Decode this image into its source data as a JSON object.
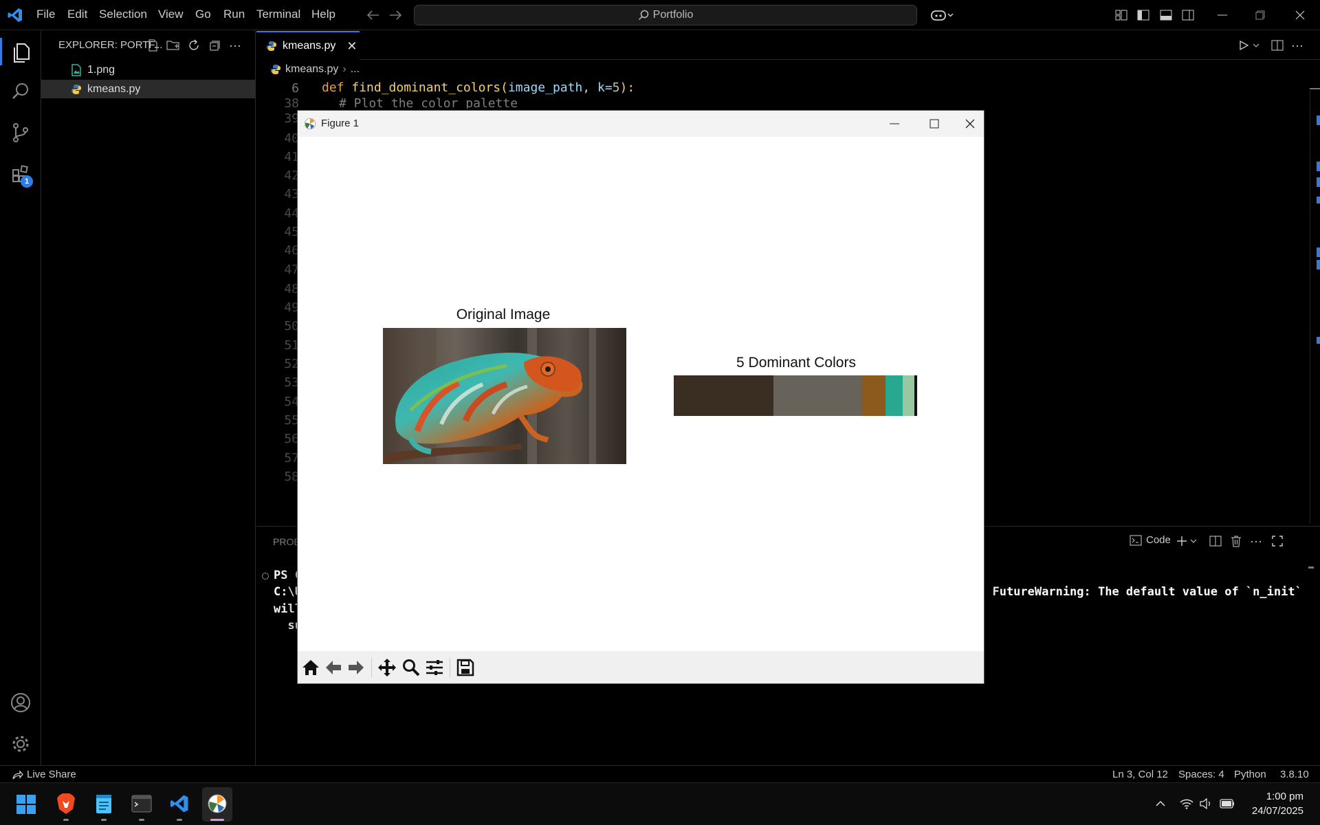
{
  "titlebar": {
    "menus": [
      "File",
      "Edit",
      "Selection",
      "View",
      "Go",
      "Run",
      "Terminal",
      "Help"
    ],
    "search": "Portfolio"
  },
  "sidebar": {
    "title": "EXPLORER: PORTF...",
    "files": [
      {
        "name": "1.png",
        "icon": "image-file-icon"
      },
      {
        "name": "kmeans.py",
        "icon": "python-file-icon"
      }
    ]
  },
  "activity": {
    "extensions_badge": "1"
  },
  "editor": {
    "tab": "kmeans.py",
    "breadcrumb_file": "kmeans.py",
    "breadcrumb_rest": "...",
    "sticky_line_number": "6",
    "sticky_code": {
      "def": "def",
      "fn": "find_dominant_colors",
      "args": "image_path, k=",
      "num": "5",
      "end": "):"
    },
    "partial_comment": "# Plot the color palette",
    "line_numbers": [
      "38",
      "39",
      "40",
      "41",
      "42",
      "43",
      "44",
      "45",
      "46",
      "47",
      "48",
      "49",
      "50",
      "51",
      "52",
      "53",
      "54",
      "55",
      "56",
      "57",
      "58"
    ]
  },
  "panel": {
    "tab_partial": "PROB",
    "terminal_name": "Code",
    "lines": [
      "PS C",
      "C:\\U",
      "will",
      "  su"
    ],
    "warning": ": FutureWarning: The default value of `n_init`"
  },
  "statusbar": {
    "live_share": "Live Share",
    "position": "Ln 3, Col 12",
    "spaces": "Spaces: 4",
    "language": "Python",
    "version": "3.8.10"
  },
  "taskbar": {
    "time": "1:00 pm",
    "date": "24/07/2025"
  },
  "figure": {
    "window_title": "Figure 1",
    "left_title": "Original Image",
    "right_title": "5 Dominant Colors",
    "palette": [
      {
        "color": "#3a2d22",
        "fraction": 0.41
      },
      {
        "color": "#67625a",
        "fraction": 0.36
      },
      {
        "color": "#8c5a1c",
        "fraction": 0.1
      },
      {
        "color": "#28a88e",
        "fraction": 0.07
      },
      {
        "color": "#98c8a0",
        "fraction": 0.05
      },
      {
        "color": "#111111",
        "fraction": 0.01
      }
    ]
  }
}
